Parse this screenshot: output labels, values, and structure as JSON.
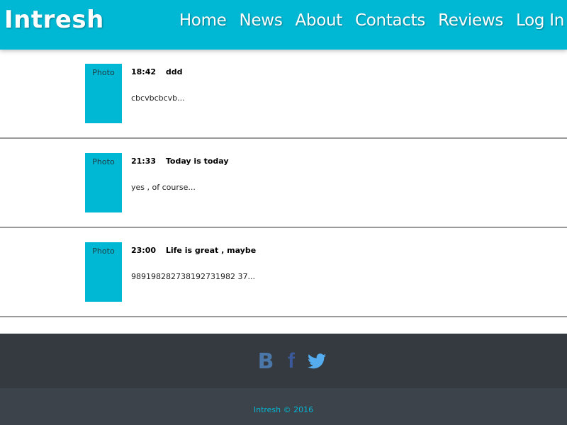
{
  "header": {
    "brand": "Intresh",
    "nav": [
      "Home",
      "News",
      "About",
      "Contacts",
      "Reviews",
      "Log In"
    ]
  },
  "posts": [
    {
      "photo_label": "Photo",
      "time": "18:42",
      "title": "ddd",
      "excerpt": "cbcvbcbcvb..."
    },
    {
      "photo_label": "Photo",
      "time": "21:33",
      "title": "Today is today",
      "excerpt": "yes , of course..."
    },
    {
      "photo_label": "Photo",
      "time": "23:00",
      "title": "Life is great , maybe",
      "excerpt": "989198282738192731982 37..."
    }
  ],
  "footer": {
    "social": [
      {
        "icon": "vk-icon",
        "glyph": "B"
      },
      {
        "icon": "facebook-icon",
        "glyph": "f"
      },
      {
        "icon": "twitter-icon"
      }
    ],
    "copyright": "Intresh © 2016"
  },
  "colors": {
    "accent": "#00b8d4",
    "footer_dark": "#343a40",
    "footer_darker": "#3d434a",
    "divider": "#9a9a9a"
  }
}
